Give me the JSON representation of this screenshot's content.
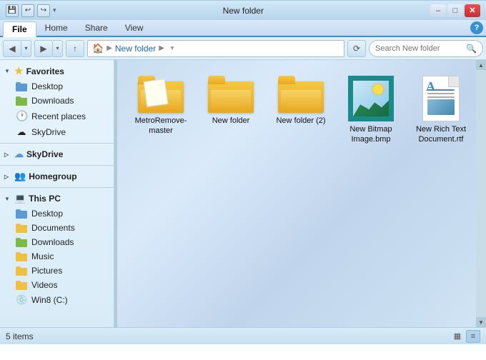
{
  "titleBar": {
    "title": "New folder",
    "windowControls": {
      "minimize": "–",
      "maximize": "□",
      "close": "✕"
    }
  },
  "quickToolbar": {
    "buttons": [
      "⬇",
      "▲",
      "▼"
    ],
    "dropdownArrow": "▾"
  },
  "ribbonTabs": {
    "tabs": [
      "File",
      "Home",
      "Share",
      "View"
    ],
    "activeTab": "Home",
    "helpLabel": "?"
  },
  "addressBar": {
    "backLabel": "◀",
    "forwardLabel": "▶",
    "upLabel": "↑",
    "refreshLabel": "⟳",
    "path": [
      "New folder"
    ],
    "dropdownArrow": "▾",
    "search": {
      "placeholder": "Search New folder",
      "icon": "🔍"
    }
  },
  "sidebar": {
    "groups": [
      {
        "id": "favorites",
        "label": "Favorites",
        "icon": "star",
        "expanded": true,
        "items": [
          {
            "label": "Desktop",
            "iconType": "desktop"
          },
          {
            "label": "Downloads",
            "iconType": "downloads"
          },
          {
            "label": "Recent places",
            "iconType": "recent"
          },
          {
            "label": "SkyDrive",
            "iconType": "skydrive"
          }
        ]
      },
      {
        "id": "skydrive",
        "label": "SkyDrive",
        "icon": "cloud",
        "expanded": false,
        "items": []
      },
      {
        "id": "homegroup",
        "label": "Homegroup",
        "icon": "network",
        "expanded": false,
        "items": []
      },
      {
        "id": "thispc",
        "label": "This PC",
        "icon": "pc",
        "expanded": true,
        "items": [
          {
            "label": "Desktop",
            "iconType": "desktop"
          },
          {
            "label": "Documents",
            "iconType": "documents"
          },
          {
            "label": "Downloads",
            "iconType": "downloads"
          },
          {
            "label": "Music",
            "iconType": "music"
          },
          {
            "label": "Pictures",
            "iconType": "pictures"
          },
          {
            "label": "Videos",
            "iconType": "videos"
          },
          {
            "label": "Win8 (C:)",
            "iconType": "drive"
          }
        ]
      }
    ]
  },
  "fileArea": {
    "items": [
      {
        "id": "metroremove",
        "label": "MetroRemove-master",
        "type": "folder"
      },
      {
        "id": "newfolder1",
        "label": "New folder",
        "type": "folder"
      },
      {
        "id": "newfolder2",
        "label": "New folder (2)",
        "type": "folder"
      },
      {
        "id": "bitmap",
        "label": "New Bitmap Image.bmp",
        "type": "bitmap"
      },
      {
        "id": "rtf",
        "label": "New Rich Text Document.rtf",
        "type": "document"
      }
    ]
  },
  "statusBar": {
    "itemCount": "5 items",
    "viewIcons": {
      "grid": "▦",
      "list": "≡"
    }
  }
}
